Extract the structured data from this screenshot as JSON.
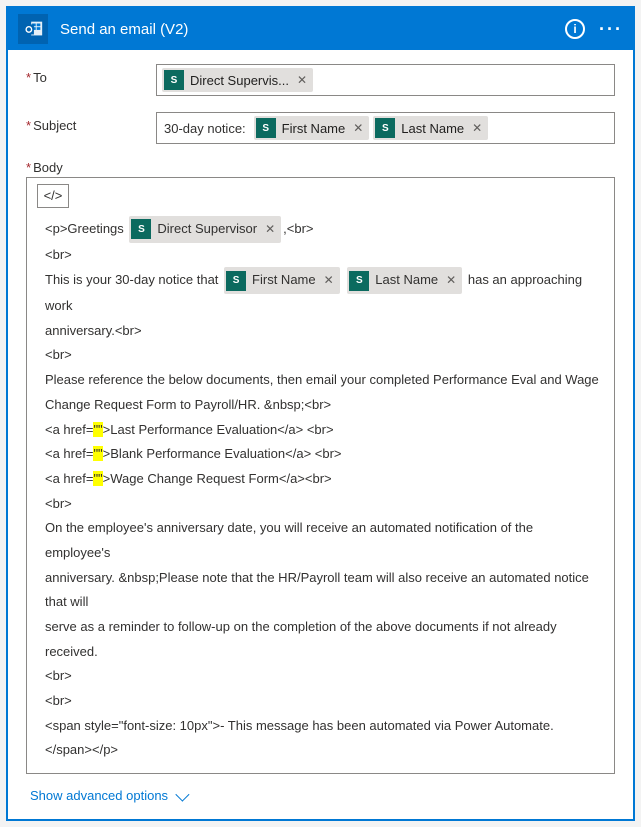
{
  "header": {
    "title": "Send an email (V2)"
  },
  "fields": {
    "to_label": "To",
    "subject_label": "Subject",
    "body_label": "Body",
    "subject_prefix": "30-day notice:"
  },
  "tokens": {
    "direct_supervisor_trunc": "Direct Supervis...",
    "direct_supervisor": "Direct Supervisor",
    "first_name": "First Name",
    "last_name": "Last Name",
    "badge_letter": "S"
  },
  "body": {
    "greet_pre": "<p>Greetings",
    "greet_post": ",<br>",
    "br": "<br>",
    "notice_pre": "This is your 30-day notice that",
    "notice_post": "has an approaching work",
    "anniversary_line": "anniversary.<br>",
    "ref_line1": "Please reference the below documents, then email your completed Performance Eval and Wage",
    "ref_line2": "Change Request Form to Payroll/HR. &nbsp;<br>",
    "link1_pre": "<a href=",
    "link1_q": "\"\"",
    "link1_post": ">Last Performance Evaluation</a> <br>",
    "link2_post": ">Blank Performance Evaluation</a> <br>",
    "link3_post": ">Wage Change Request Form</a><br>",
    "para1": "On the employee's anniversary date, you will receive an automated notification of the employee's",
    "para2": "anniversary. &nbsp;Please note that the HR/Payroll team will also receive an automated notice that will",
    "para3": "serve as a reminder to follow-up on the completion of the above documents if not already received.",
    "footer": "<span style=\"font-size: 10px\">- This message has been automated via Power Automate.</span></p>",
    "code_toggle": "</>"
  },
  "footer": {
    "advanced": "Show advanced options"
  }
}
